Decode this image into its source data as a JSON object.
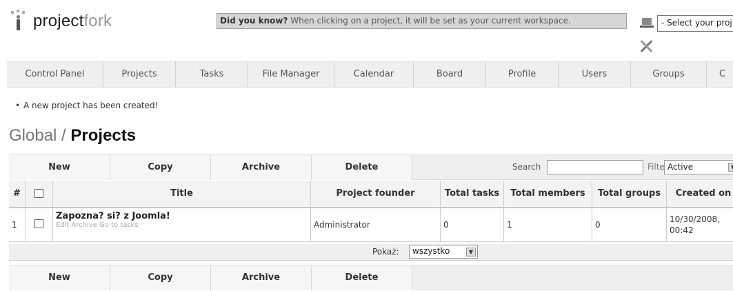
{
  "header": {
    "logo_bold": "project",
    "logo_light": "fork",
    "tip_label": "Did you know?",
    "tip_text": " When clicking on a project, it will be set as your current workspace.",
    "workspace_select": "- Select your proj"
  },
  "nav": {
    "items": [
      "Control Panel",
      "Projects",
      "Tasks",
      "File Manager",
      "Calendar",
      "Board",
      "Profile",
      "Users",
      "Groups",
      "C"
    ]
  },
  "message": "A new project has been created!",
  "title": {
    "prefix": "Global",
    "separator": " / ",
    "main": "Projects"
  },
  "toolbar": {
    "new": "New",
    "copy": "Copy",
    "archive": "Archive",
    "delete": "Delete",
    "search_label": "Search",
    "filter_label": "Filter",
    "filter_value": "Active"
  },
  "table": {
    "headers": {
      "num": "#",
      "title": "Title",
      "founder": "Project founder",
      "tasks": "Total tasks",
      "members": "Total members",
      "groups": "Total groups",
      "created": "Created on"
    },
    "rows": [
      {
        "num": "1",
        "title": "Zapozna? si? z Joomla!",
        "links": "Edit  Archive  Go to tasks",
        "founder": "Administrator",
        "tasks": "0",
        "members": "1",
        "groups": "0",
        "created_date": "10/30/2008,",
        "created_time": "00:42"
      }
    ]
  },
  "pager": {
    "label": "Pokaż:",
    "value": "wszystko"
  }
}
